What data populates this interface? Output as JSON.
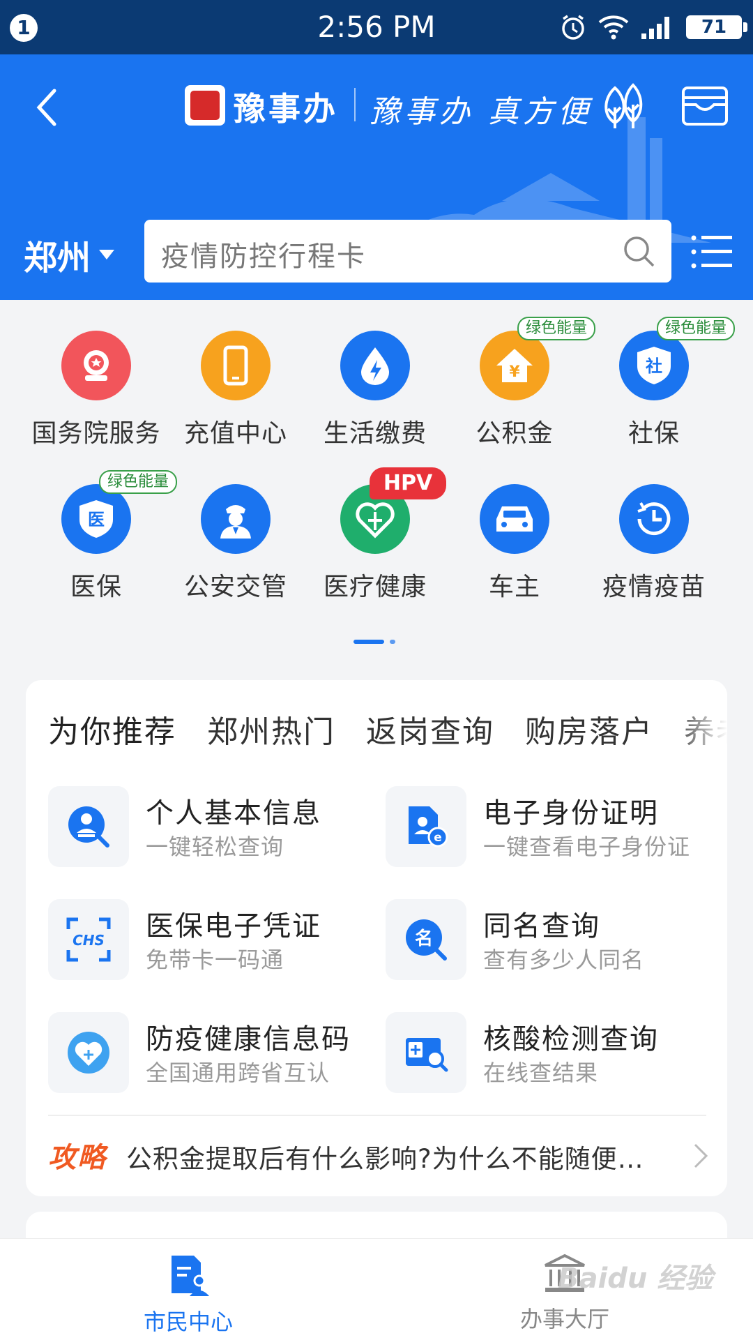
{
  "status": {
    "notification_count": "1",
    "time": "2:56 PM",
    "battery": "71"
  },
  "header": {
    "brand": "豫事办",
    "slogan": "豫事办 真方便",
    "city": "郑州",
    "search_placeholder": "疫情防控行程卡",
    "accent_color": "#1a74f0"
  },
  "grid": [
    {
      "label": "国务院服务",
      "icon": "national-emblem-icon",
      "color": "#f2555b"
    },
    {
      "label": "充值中心",
      "icon": "phone-icon",
      "color": "#f7a21e"
    },
    {
      "label": "生活缴费",
      "icon": "lightning-drop-icon",
      "color": "#1a74f0"
    },
    {
      "label": "公积金",
      "icon": "house-yen-icon",
      "color": "#f7a21e",
      "badge": "绿色能量"
    },
    {
      "label": "社保",
      "icon": "shield-she-icon",
      "color": "#1a74f0",
      "badge": "绿色能量",
      "glyph": "社"
    },
    {
      "label": "医保",
      "icon": "shield-yi-icon",
      "color": "#1a74f0",
      "badge": "绿色能量",
      "glyph": "医"
    },
    {
      "label": "公安交管",
      "icon": "police-icon",
      "color": "#1a74f0"
    },
    {
      "label": "医疗健康",
      "icon": "heart-cross-icon",
      "color": "#1fae6c",
      "badge_hot": "HPV"
    },
    {
      "label": "车主",
      "icon": "car-icon",
      "color": "#1a74f0"
    },
    {
      "label": "疫情疫苗",
      "icon": "clock-history-icon",
      "color": "#1a74f0"
    }
  ],
  "tabs": [
    "为你推荐",
    "郑州热门",
    "返岗查询",
    "购房落户",
    "养老"
  ],
  "services": [
    {
      "title": "个人基本信息",
      "subtitle": "一键轻松查询",
      "icon": "person-search-icon"
    },
    {
      "title": "电子身份证明",
      "subtitle": "一键查看电子身份证",
      "icon": "e-id-icon"
    },
    {
      "title": "医保电子凭证",
      "subtitle": "免带卡一码通",
      "icon": "chs-scan-icon",
      "glyph": "CHS"
    },
    {
      "title": "同名查询",
      "subtitle": "查有多少人同名",
      "icon": "name-search-icon",
      "glyph": "名"
    },
    {
      "title": "防疫健康信息码",
      "subtitle": "全国通用跨省互认",
      "icon": "health-heart-icon"
    },
    {
      "title": "核酸检测查询",
      "subtitle": "在线查结果",
      "icon": "test-kit-search-icon"
    }
  ],
  "tip": {
    "tag": "攻略",
    "text": "公积金提取后有什么影响?为什么不能随便…"
  },
  "nav": [
    {
      "label": "市民中心",
      "icon": "citizen-doc-icon"
    },
    {
      "label": "办事大厅",
      "icon": "hall-building-icon"
    }
  ],
  "watermark": "Baidu 经验"
}
